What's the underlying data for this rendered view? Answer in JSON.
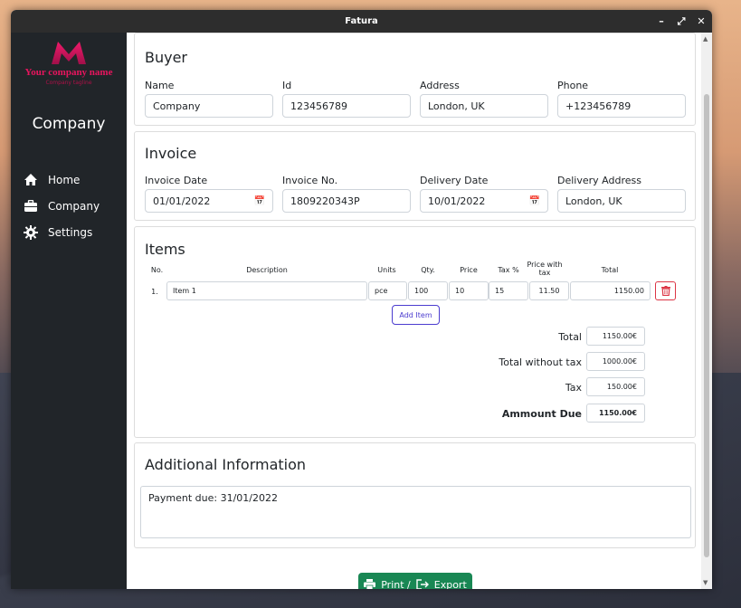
{
  "window": {
    "title": "Fatura",
    "controls": [
      "minimize-icon",
      "maximize-icon",
      "close-icon"
    ]
  },
  "sidebar": {
    "logo_name": "Your company name",
    "logo_tagline": "Company tagline",
    "company": "Company",
    "items": [
      {
        "label": "Home",
        "icon": "home-icon"
      },
      {
        "label": "Company",
        "icon": "briefcase-icon"
      },
      {
        "label": "Settings",
        "icon": "gear-icon"
      }
    ]
  },
  "buyer": {
    "title": "Buyer",
    "fields": [
      {
        "label": "Name",
        "value": "Company"
      },
      {
        "label": "Id",
        "value": "123456789"
      },
      {
        "label": "Address",
        "value": "London, UK"
      },
      {
        "label": "Phone",
        "value": "+123456789"
      }
    ]
  },
  "invoice": {
    "title": "Invoice",
    "fields": [
      {
        "label": "Invoice Date",
        "value": "01/01/2022"
      },
      {
        "label": "Invoice No.",
        "value": "1809220343P"
      },
      {
        "label": "Delivery Date",
        "value": "10/01/2022"
      },
      {
        "label": "Delivery Address",
        "value": "London, UK"
      }
    ]
  },
  "items": {
    "title": "Items",
    "headers": {
      "no": "No.",
      "description": "Description",
      "units": "Units",
      "qty": "Qty.",
      "price": "Price",
      "tax": "Tax %",
      "price_tax_1": "Price with",
      "price_tax_2": "tax",
      "total": "Total"
    },
    "rows": [
      {
        "no": "1.",
        "description": "Item 1",
        "units": "pce",
        "qty": "100",
        "price": "10",
        "tax": "15",
        "price_tax": "11.50",
        "total": "1150.00"
      }
    ],
    "add_label": "Add Item"
  },
  "summary": {
    "total_label": "Total",
    "total": "1150.00€",
    "notax_label": "Total without tax",
    "notax": "1000.00€",
    "tax_label": "Tax",
    "tax": "150.00€",
    "due_label": "Ammount Due",
    "due": "1150.00€"
  },
  "additional": {
    "title": "Additional Information",
    "text": "Payment due: 31/01/2022"
  },
  "print": {
    "label1": "Print /",
    "label2": "Export"
  },
  "colors": {
    "sidebar": "#212529",
    "brand": "#e8155e",
    "success": "#198754",
    "danger": "#dc3545",
    "accent": "#4b3ccf"
  }
}
